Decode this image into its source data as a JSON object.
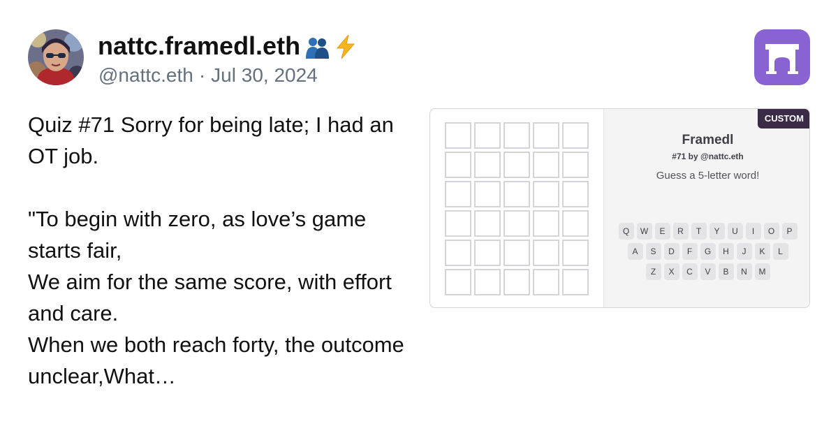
{
  "author": {
    "display_name": "nattc.framedl.eth",
    "emoji_icons": [
      "people-hugging-icon",
      "lightning-icon"
    ],
    "handle": "@nattc.eth",
    "separator": "·",
    "date": "Jul 30, 2024",
    "avatar": "avatar-image"
  },
  "app_logo": {
    "icon": "arch-icon",
    "color": "#8a63d2"
  },
  "cast": {
    "text": "Quiz #71 Sorry for being late; I had an OT job.\n\n\"To begin with zero, as love’s game starts fair,\nWe aim for the same score, with effort and care.\nWhen we both reach forty, the outcome unclear,What…"
  },
  "frame": {
    "badge": "CUSTOM",
    "title": "Framedl",
    "subtitle": "#71 by @nattc.eth",
    "prompt": "Guess a 5-letter word!",
    "keyboard": [
      [
        "Q",
        "W",
        "E",
        "R",
        "T",
        "Y",
        "U",
        "I",
        "O",
        "P"
      ],
      [
        "A",
        "S",
        "D",
        "F",
        "G",
        "H",
        "J",
        "K",
        "L"
      ],
      [
        "Z",
        "X",
        "C",
        "V",
        "B",
        "N",
        "M"
      ]
    ],
    "colors": {
      "badge": "#3a2b47",
      "panel": "#f4f4f5",
      "key": "#e4e4e7",
      "cell_border": "#d4d4d8"
    }
  }
}
